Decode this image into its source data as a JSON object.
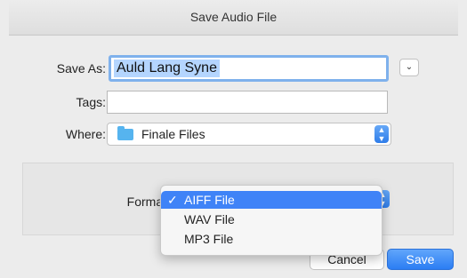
{
  "window": {
    "title": "Save Audio File"
  },
  "form": {
    "save_as_label": "Save As:",
    "save_as_value": "Auld Lang Syne",
    "tags_label": "Tags:",
    "tags_value": "",
    "where_label": "Where:",
    "where_value": "Finale Files"
  },
  "format": {
    "label": "Format",
    "options": [
      "AIFF File",
      "WAV File",
      "MP3 File"
    ],
    "selected": "AIFF File",
    "check": "✓"
  },
  "buttons": {
    "cancel": "Cancel",
    "save": "Save"
  },
  "icons": {
    "disclosure": "chevron-down-icon",
    "stepper": "up-down-chevron-icon",
    "folder": "folder-icon"
  },
  "colors": {
    "accent": "#3f83f7",
    "selection": "#b4d5fe",
    "folder": "#56b4ef"
  }
}
